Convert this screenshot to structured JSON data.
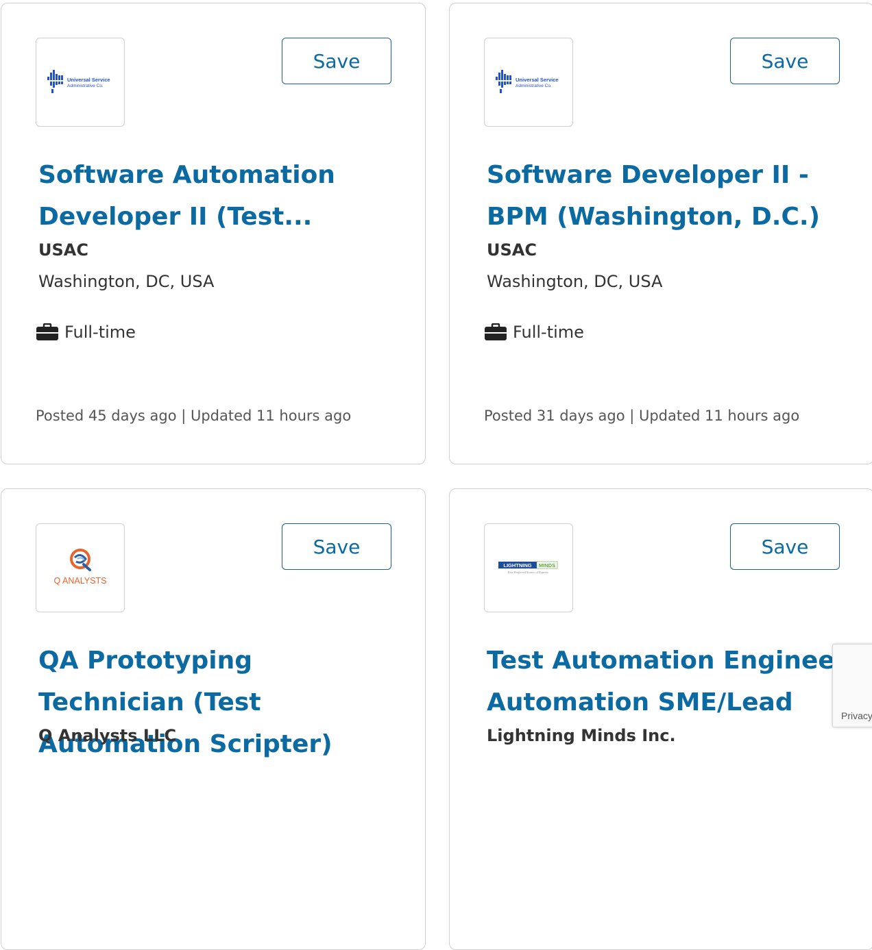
{
  "cards": [
    {
      "logo": {
        "name": "usac-logo",
        "text_line1": "Universal Service",
        "text_line2": "Administrative Co."
      },
      "save_label": "Save",
      "title": "Software Automation Developer II (Test...",
      "company": "USAC",
      "location": "Washington, DC, USA",
      "job_type": "Full-time",
      "job_type_icon": "briefcase-icon",
      "posted": "Posted 45 days ago | Updated 11 hours ago"
    },
    {
      "logo": {
        "name": "usac-logo",
        "text_line1": "Universal Service",
        "text_line2": "Administrative Co."
      },
      "save_label": "Save",
      "title": "Software Developer II - BPM (Washington, D.C.)",
      "company": "USAC",
      "location": "Washington, DC, USA",
      "job_type": "Full-time",
      "job_type_icon": "briefcase-icon",
      "posted": "Posted 31 days ago | Updated 11 hours ago"
    },
    {
      "logo": {
        "name": "q-analysts-logo",
        "text_line1": "Q ANALYSTS"
      },
      "save_label": "Save",
      "title": "QA Prototyping Technician (Test Automation Scripter)",
      "company": "Q Analysts LLC"
    },
    {
      "logo": {
        "name": "lightning-minds-logo",
        "text_line1": "LIGHTNING",
        "text_line2": "MINDS",
        "tagline": "Your Preferred Source of Experts"
      },
      "save_label": "Save",
      "title": "Test Automation Engineer Automation SME/Lead",
      "company": "Lightning Minds Inc."
    }
  ],
  "recaptcha": {
    "privacy_label": "Privacy"
  },
  "colors": {
    "title": "#0b6aa2",
    "button_border": "#1b5e8f",
    "text": "#333333",
    "usac_blue": "#1f4fe0",
    "q_orange": "#e8642c",
    "lm_blue": "#1e4d9c",
    "lm_green": "#5aa832"
  }
}
